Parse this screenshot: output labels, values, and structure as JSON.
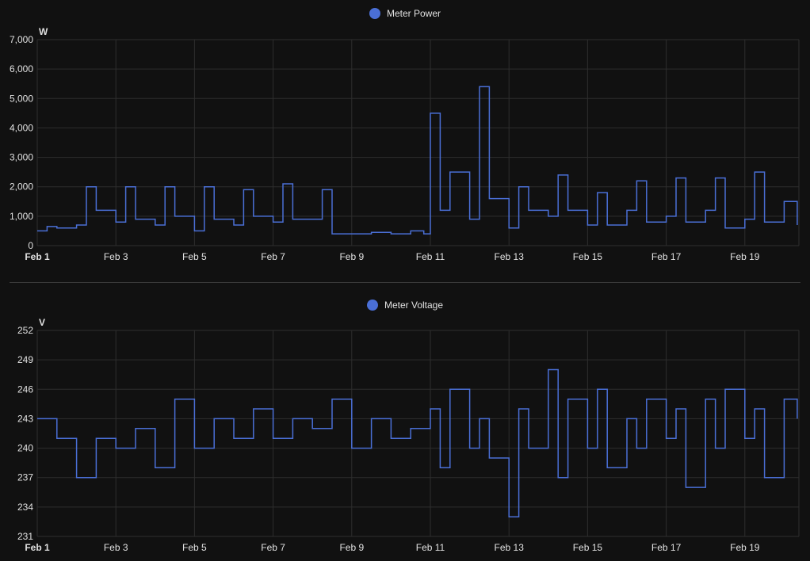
{
  "chart_data": [
    {
      "type": "line",
      "series": [
        {
          "name": "Meter Power",
          "values": []
        }
      ],
      "ylabel": "W",
      "ylim": [
        0,
        7000
      ],
      "yticks": [
        0,
        1000,
        2000,
        3000,
        4000,
        5000,
        6000,
        7000
      ],
      "ytick_labels": [
        "0",
        "1,000",
        "2,000",
        "3,000",
        "4,000",
        "5,000",
        "6,000",
        "7,000"
      ],
      "xlim": [
        "2025-02-01",
        "2025-02-20T09:00"
      ],
      "xtick_labels": [
        "Feb 1",
        "Feb 3",
        "Feb 5",
        "Feb 7",
        "Feb 9",
        "Feb 11",
        "Feb 13",
        "Feb 15",
        "Feb 17",
        "Feb 19"
      ],
      "xticks": [
        "2025-02-01",
        "2025-02-03",
        "2025-02-05",
        "2025-02-07",
        "2025-02-09",
        "2025-02-11",
        "2025-02-13",
        "2025-02-15",
        "2025-02-17",
        "2025-02-19"
      ],
      "grid": true,
      "legend": "top-center",
      "color": "#4a6fd6",
      "x": [
        "2025-02-01T00:00",
        "2025-02-01T06:00",
        "2025-02-01T12:00",
        "2025-02-02T00:00",
        "2025-02-02T06:00",
        "2025-02-02T12:00",
        "2025-02-03T00:00",
        "2025-02-03T06:00",
        "2025-02-03T12:00",
        "2025-02-04T00:00",
        "2025-02-04T06:00",
        "2025-02-04T12:00",
        "2025-02-05T00:00",
        "2025-02-05T06:00",
        "2025-02-05T12:00",
        "2025-02-06T00:00",
        "2025-02-06T06:00",
        "2025-02-06T12:00",
        "2025-02-07T00:00",
        "2025-02-07T06:00",
        "2025-02-07T12:00",
        "2025-02-08T00:00",
        "2025-02-08T06:00",
        "2025-02-08T12:00",
        "2025-02-09T00:00",
        "2025-02-09T12:00",
        "2025-02-10T00:00",
        "2025-02-10T12:00",
        "2025-02-10T20:00",
        "2025-02-11T00:00",
        "2025-02-11T06:00",
        "2025-02-11T12:00",
        "2025-02-12T00:00",
        "2025-02-12T06:00",
        "2025-02-12T12:00",
        "2025-02-13T00:00",
        "2025-02-13T06:00",
        "2025-02-13T12:00",
        "2025-02-14T00:00",
        "2025-02-14T06:00",
        "2025-02-14T12:00",
        "2025-02-15T00:00",
        "2025-02-15T06:00",
        "2025-02-15T12:00",
        "2025-02-16T00:00",
        "2025-02-16T06:00",
        "2025-02-16T12:00",
        "2025-02-17T00:00",
        "2025-02-17T06:00",
        "2025-02-17T12:00",
        "2025-02-18T00:00",
        "2025-02-18T06:00",
        "2025-02-18T12:00",
        "2025-02-19T00:00",
        "2025-02-19T06:00",
        "2025-02-19T12:00",
        "2025-02-20T00:00",
        "2025-02-20T08:00"
      ],
      "y": [
        500,
        650,
        600,
        700,
        2000,
        1200,
        800,
        2000,
        900,
        700,
        2000,
        1000,
        500,
        2000,
        900,
        700,
        1900,
        1000,
        800,
        2100,
        900,
        900,
        1900,
        400,
        400,
        450,
        400,
        500,
        400,
        4500,
        1200,
        2500,
        900,
        5400,
        1600,
        600,
        2000,
        1200,
        1000,
        2400,
        1200,
        700,
        1800,
        700,
        1200,
        2200,
        800,
        1000,
        2300,
        800,
        1200,
        2300,
        600,
        900,
        2500,
        800,
        1500,
        700
      ]
    },
    {
      "type": "line",
      "series": [
        {
          "name": "Meter Voltage",
          "values": []
        }
      ],
      "ylabel": "V",
      "ylim": [
        231,
        252
      ],
      "yticks": [
        231,
        234,
        237,
        240,
        243,
        246,
        249,
        252
      ],
      "ytick_labels": [
        "231",
        "234",
        "237",
        "240",
        "243",
        "246",
        "249",
        "252"
      ],
      "xlim": [
        "2025-02-01",
        "2025-02-20T09:00"
      ],
      "xtick_labels": [
        "Feb 1",
        "Feb 3",
        "Feb 5",
        "Feb 7",
        "Feb 9",
        "Feb 11",
        "Feb 13",
        "Feb 15",
        "Feb 17",
        "Feb 19"
      ],
      "xticks": [
        "2025-02-01",
        "2025-02-03",
        "2025-02-05",
        "2025-02-07",
        "2025-02-09",
        "2025-02-11",
        "2025-02-13",
        "2025-02-15",
        "2025-02-17",
        "2025-02-19"
      ],
      "grid": true,
      "legend": "top-center",
      "color": "#4a6fd6",
      "x": [
        "2025-02-01T00:00",
        "2025-02-01T12:00",
        "2025-02-02T00:00",
        "2025-02-02T12:00",
        "2025-02-03T00:00",
        "2025-02-03T12:00",
        "2025-02-04T00:00",
        "2025-02-04T12:00",
        "2025-02-05T00:00",
        "2025-02-05T12:00",
        "2025-02-06T00:00",
        "2025-02-06T12:00",
        "2025-02-07T00:00",
        "2025-02-07T12:00",
        "2025-02-08T00:00",
        "2025-02-08T12:00",
        "2025-02-09T00:00",
        "2025-02-09T12:00",
        "2025-02-10T00:00",
        "2025-02-10T12:00",
        "2025-02-11T00:00",
        "2025-02-11T06:00",
        "2025-02-11T12:00",
        "2025-02-12T00:00",
        "2025-02-12T06:00",
        "2025-02-12T12:00",
        "2025-02-13T00:00",
        "2025-02-13T06:00",
        "2025-02-13T12:00",
        "2025-02-14T00:00",
        "2025-02-14T06:00",
        "2025-02-14T12:00",
        "2025-02-15T00:00",
        "2025-02-15T06:00",
        "2025-02-15T12:00",
        "2025-02-16T00:00",
        "2025-02-16T06:00",
        "2025-02-16T12:00",
        "2025-02-17T00:00",
        "2025-02-17T06:00",
        "2025-02-17T12:00",
        "2025-02-18T00:00",
        "2025-02-18T06:00",
        "2025-02-18T12:00",
        "2025-02-19T00:00",
        "2025-02-19T06:00",
        "2025-02-19T12:00",
        "2025-02-20T00:00",
        "2025-02-20T08:00"
      ],
      "y": [
        243,
        241,
        237,
        241,
        240,
        242,
        238,
        245,
        240,
        243,
        241,
        244,
        241,
        243,
        242,
        245,
        240,
        243,
        241,
        242,
        244,
        238,
        246,
        240,
        243,
        239,
        233,
        244,
        240,
        248,
        237,
        245,
        240,
        246,
        238,
        243,
        240,
        245,
        241,
        244,
        236,
        245,
        240,
        246,
        241,
        244,
        237,
        245,
        243
      ]
    }
  ]
}
